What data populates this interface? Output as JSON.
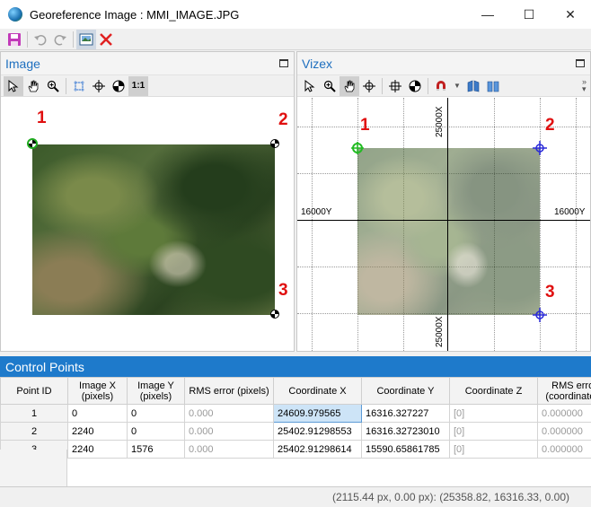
{
  "window": {
    "title": "Georeference Image : MMI_IMAGE.JPG",
    "controls": {
      "minimize": "—",
      "maximize": "☐",
      "close": "✕"
    }
  },
  "toolbar": {
    "icons": [
      "save-icon",
      "undo-icon",
      "redo-icon",
      "image-properties-icon",
      "delete-icon"
    ]
  },
  "image_pane": {
    "title": "Image",
    "tools": [
      "select-arrow-icon",
      "pan-hand-icon",
      "zoom-icon",
      "fit-extent-icon",
      "crosshair-icon",
      "control-point-icon",
      "one-to-one-zoom-icon"
    ],
    "one_to_one_label": "1:1",
    "points": [
      {
        "label": "1"
      },
      {
        "label": "2"
      },
      {
        "label": "3"
      }
    ]
  },
  "vizex_pane": {
    "title": "Vizex",
    "tools": [
      "select-arrow-icon",
      "zoom-icon",
      "pan-hand-icon",
      "crosshair-icon",
      "crosshair-move-icon",
      "control-point-icon",
      "magnet-icon",
      "book-icon",
      "book-alt-icon"
    ],
    "grid_labels": {
      "top_x": "25000X",
      "bottom_x": "25000X",
      "left_y": "16000Y",
      "right_y": "16000Y"
    },
    "points": [
      {
        "label": "1"
      },
      {
        "label": "2"
      },
      {
        "label": "3"
      }
    ]
  },
  "control_points": {
    "title": "Control Points",
    "columns": [
      "Point ID",
      "Image X (pixels)",
      "Image Y (pixels)",
      "RMS error (pixels)",
      "Coordinate X",
      "Coordinate Y",
      "Coordinate Z",
      "RMS error (coordinates)"
    ],
    "rows": [
      {
        "id": "1",
        "image_x": "0",
        "image_y": "0",
        "rms_px": "0.000",
        "coord_x": "24609.979565",
        "coord_y": "16316.327227",
        "coord_z": "[0]",
        "rms_coord": "0.000000"
      },
      {
        "id": "2",
        "image_x": "2240",
        "image_y": "0",
        "rms_px": "0.000",
        "coord_x": "25402.91298553",
        "coord_y": "16316.32723010",
        "coord_z": "[0]",
        "rms_coord": "0.000000"
      },
      {
        "id": "3",
        "image_x": "2240",
        "image_y": "1576",
        "rms_px": "0.000",
        "coord_x": "25402.91298614",
        "coord_y": "15590.65861785",
        "coord_z": "[0]",
        "rms_coord": "0.000000"
      }
    ]
  },
  "status": {
    "text": "(2115.44 px, 0.00 px): (25358.82, 16316.33, 0.00)"
  },
  "colors": {
    "accent": "#1e7acb",
    "point_label": "#e01010",
    "pane_title": "#1e6fbf",
    "vizex_point1": "#22bb22",
    "vizex_point_other": "#2a2ad8"
  }
}
